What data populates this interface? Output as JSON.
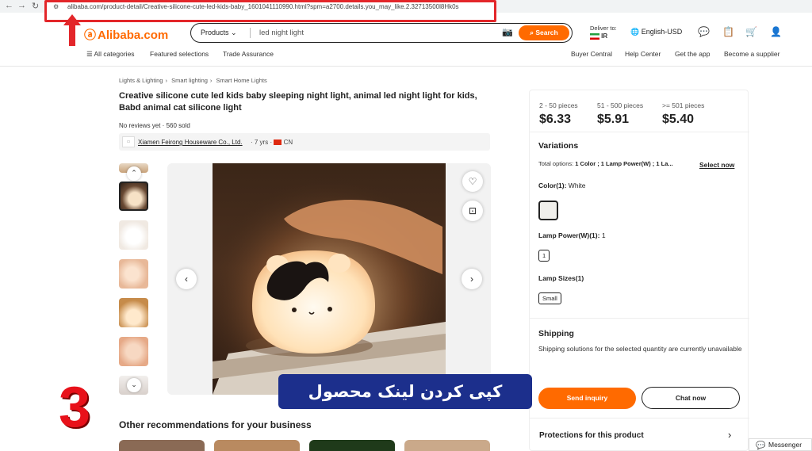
{
  "browser": {
    "url": "alibaba.com/product-detail/Creative-silicone-cute-led-kids-baby_1601041110990.html?spm=a2700.details.you_may_like.2.32713500l8Hk0s"
  },
  "header": {
    "logo": "Alibaba.com",
    "search_category": "Products",
    "search_query": "led night light",
    "search_button": "Search",
    "deliver_label": "Deliver to:",
    "deliver_country": "IR",
    "language": "English-USD"
  },
  "subnav": {
    "left": [
      "All categories",
      "Featured selections",
      "Trade Assurance"
    ],
    "right": [
      "Buyer Central",
      "Help Center",
      "Get the app",
      "Become a supplier"
    ]
  },
  "product": {
    "breadcrumb": [
      "Lights & Lighting",
      "Smart lighting",
      "Smart Home Lights"
    ],
    "title": "Creative silicone cute led kids baby sleeping night light, animal led night light for kids, Babd animal cat silicone light",
    "reviews": "No reviews yet · 560 sold",
    "supplier_name": "Xiamen Feirong Houseware Co., Ltd.",
    "supplier_years": "· 7 yrs ·",
    "supplier_country": "CN"
  },
  "pricing": {
    "tiers": [
      {
        "range": "2 - 50 pieces",
        "price": "$6.33"
      },
      {
        "range": "51 - 500 pieces",
        "price": "$5.91"
      },
      {
        "range": ">= 501 pieces",
        "price": "$5.40"
      }
    ]
  },
  "variations": {
    "title": "Variations",
    "total_label": "Total options:",
    "total_value": "1 Color ; 1 Lamp Power(W) ; 1 La...",
    "select_now": "Select now",
    "color_label": "Color(1):",
    "color_value": "White",
    "power_label": "Lamp Power(W)(1):",
    "power_value": "1",
    "power_chip": "1",
    "size_label": "Lamp Sizes(1)",
    "size_chip": "Small"
  },
  "shipping": {
    "title": "Shipping",
    "text": "Shipping solutions for the selected quantity are currently unavailable"
  },
  "actions": {
    "inquiry": "Send inquiry",
    "chat": "Chat now",
    "protections": "Protections for this product"
  },
  "recommendations": {
    "title": "Other recommendations for your business"
  },
  "overlay": {
    "step_number": "3",
    "caption": "کپی کردن لینک محصول"
  },
  "messenger": {
    "label": "Messenger"
  },
  "colors": {
    "accent": "#ff6a00",
    "annotation_red": "#e3262a",
    "caption_bg": "#1c2f8c"
  }
}
